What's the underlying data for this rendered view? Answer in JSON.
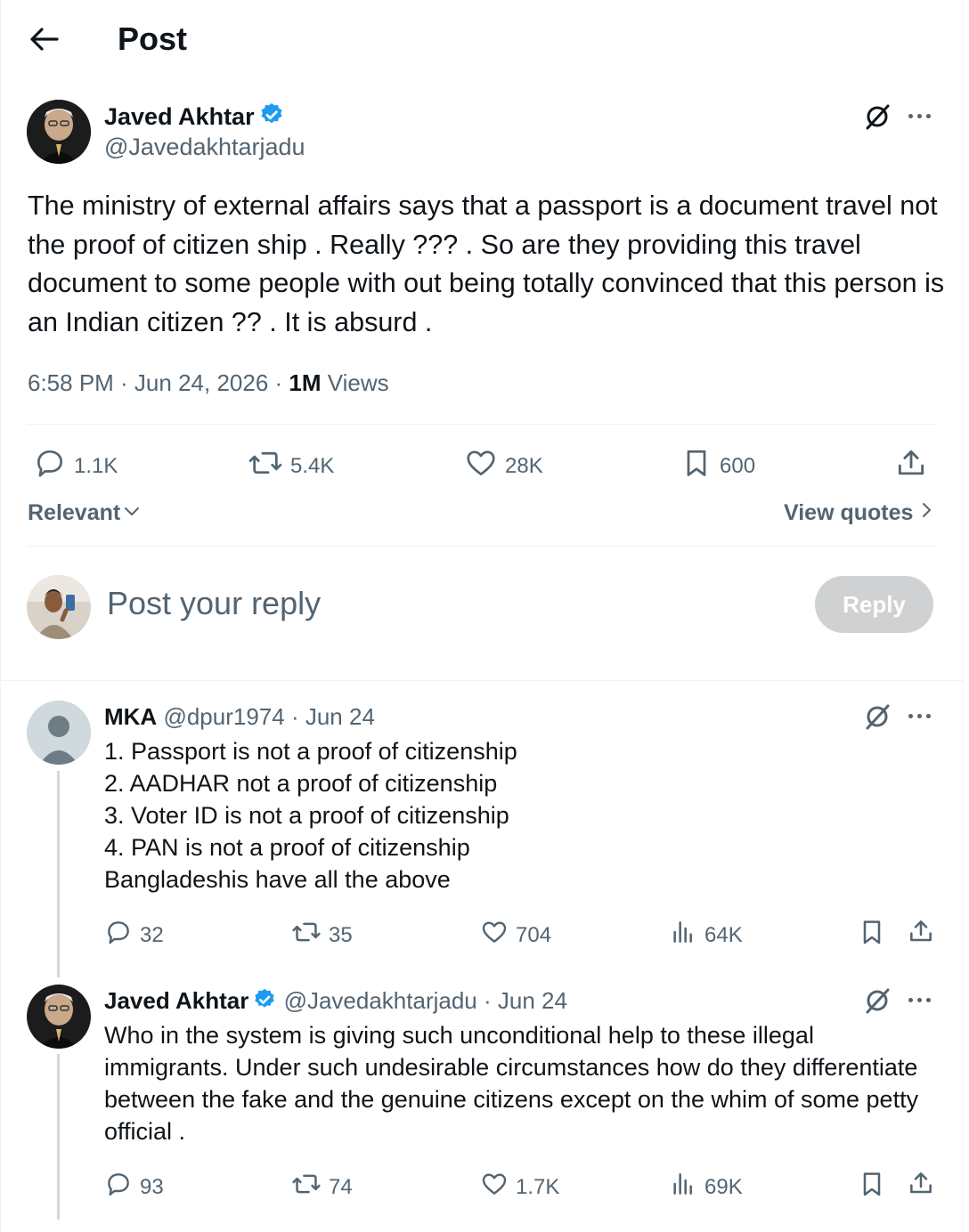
{
  "header": {
    "title": "Post"
  },
  "post": {
    "author_name": "Javed Akhtar",
    "author_handle": "@Javedakhtarjadu",
    "text": "The ministry of external affairs says  that a passport is a document travel not the proof of citizen ship . Really ??? . So are they providing this travel document to some people with out being totally convinced that this person is an Indian citizen ?? . It is absurd .",
    "time": "6:58 PM · Jun 24, 2026 · ",
    "views_count": "1M",
    "views_label": " Views",
    "replies": "1.1K",
    "reposts": "5.4K",
    "likes": "28K",
    "bookmarks": "600"
  },
  "sort": {
    "label": "Relevant",
    "view_quotes": "View quotes"
  },
  "composer": {
    "placeholder": "Post your reply",
    "reply_button": "Reply"
  },
  "replies": [
    {
      "name": "MKA",
      "handle": "@dpur1974",
      "date": "· Jun 24",
      "lines": [
        "1. Passport is not a proof of citizenship",
        "2. AADHAR not a proof of citizenship",
        "3. Voter ID is not a proof of citizenship",
        "4. PAN is not a proof of citizenship",
        "Bangladeshis have all the above"
      ],
      "replies": "32",
      "reposts": "35",
      "likes": "704",
      "views": "64K"
    },
    {
      "name": "Javed Akhtar",
      "handle": "@Javedakhtarjadu",
      "date": "· Jun 24",
      "text": "Who in the system is giving such unconditional help to these illegal immigrants. Under such undesirable circumstances how do they differentiate between the fake and the genuine citizens except on the whim of some petty official .",
      "replies": "93",
      "reposts": "74",
      "likes": "1.7K",
      "views": "69K"
    }
  ],
  "colors": {
    "text": "#0f1419",
    "secondary": "#536471",
    "verified": "#1d9bf0",
    "divider": "#eff3f4",
    "reply_button_disabled": "#cfd1d2"
  },
  "icons": [
    "back-arrow-icon",
    "verified-badge-icon",
    "grok-icon",
    "more-icon",
    "reply-icon",
    "repost-icon",
    "like-icon",
    "bookmark-icon",
    "share-icon",
    "views-icon",
    "chevron-down-icon",
    "chevron-right-icon"
  ]
}
